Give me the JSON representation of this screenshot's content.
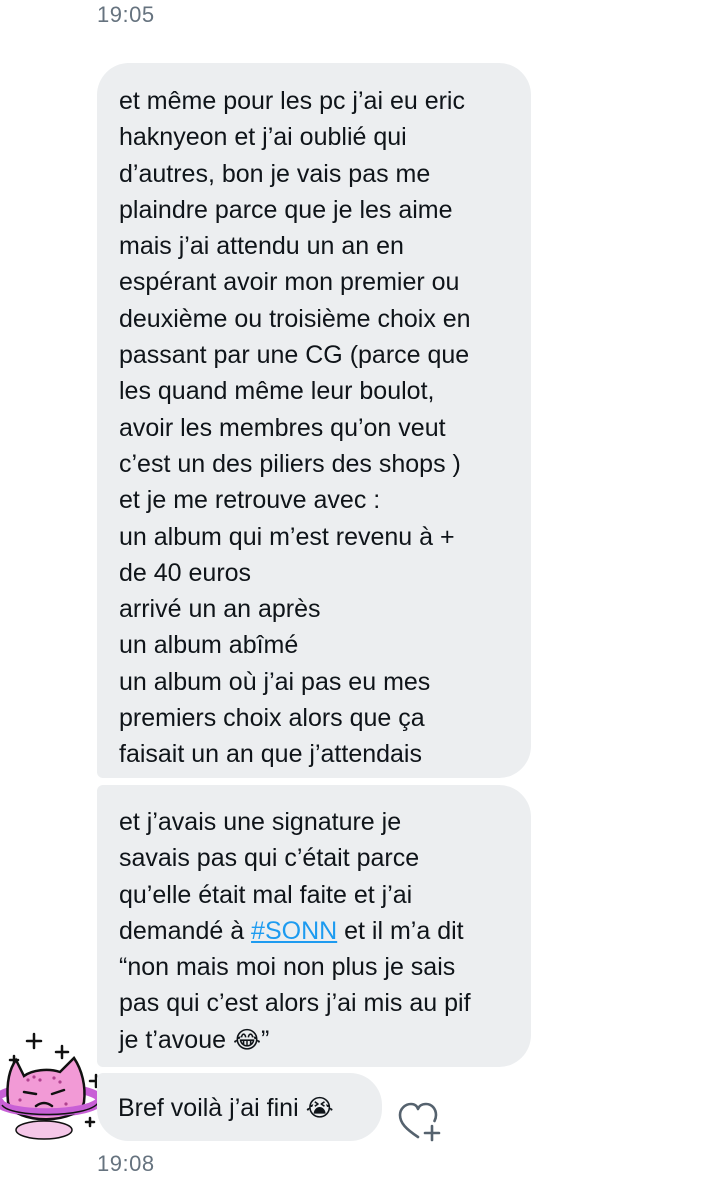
{
  "conversation": {
    "timestamp_top": "19:05",
    "timestamp_bottom": "19:08",
    "messages": [
      {
        "text": "et même pour les pc j’ai eu eric\nhaknyeon et j’ai oublié qui\nd’autres, bon je vais pas me\nplaindre parce que je les aime\nmais j’ai attendu un an en\nespérant avoir mon premier ou\ndeuxième ou troisième choix en\npassant par une CG (parce que\nles quand même leur boulot,\navoir les membres qu’on veut\nc’est un des piliers des shops )\net je me retrouve avec :\nun album qui m’est revenu à +\nde 40 euros\narrivé un an après\nun album abîmé\nun album où j’ai pas eu mes\npremiers choix alors que ça\nfaisait un an que j’attendais"
      },
      {
        "line1": "et j’avais une signature je",
        "line2": "savais pas qui c’était parce",
        "line3": "qu’elle était mal faite et j’ai",
        "line4_before": "demandé à ",
        "hashtag": "#SONN",
        "line4_after": " et il m’a dit",
        "line5": "“non mais moi non plus je sais",
        "line6": "pas qui c’est alors j’ai mis au pif",
        "line7_text": "je t’avoue ",
        "line7_emoji": "😂",
        "line7_end": "”"
      },
      {
        "text": "Bref voilà j’ai fini ",
        "emoji": "😭"
      }
    ]
  },
  "icons": {
    "avatar": "pink-cat-planet-avatar",
    "reaction": "heart-plus-icon"
  },
  "colors": {
    "bubble_bg": "#eceef0",
    "timestamp": "#66737f",
    "hashtag": "#1d9bf0",
    "avatar_pink": "#f29ad6",
    "avatar_ring": "#c860d6"
  }
}
